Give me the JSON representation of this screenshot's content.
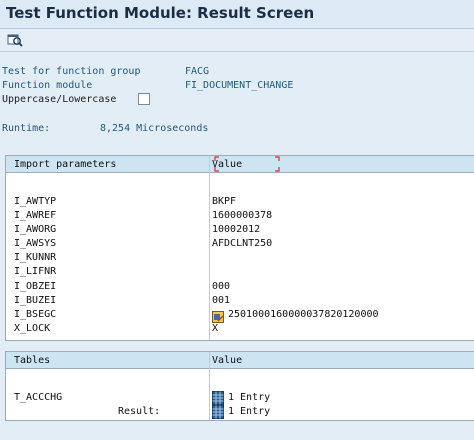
{
  "window": {
    "title": "Test Function Module: Result Screen"
  },
  "toolbar": {
    "icon": "display-magnifier-icon"
  },
  "header": {
    "group_label": "Test for function group",
    "group_value": "FACG",
    "module_label": "Function module",
    "module_value": "FI_DOCUMENT_CHANGE",
    "case_label": "Uppercase/Lowercase",
    "case_checked": false,
    "runtime_label": "Runtime:",
    "runtime_value": "8,254 Microseconds"
  },
  "import_table": {
    "col1": "Import parameters",
    "col2": "Value",
    "rows": [
      {
        "name": "I_AWTYP",
        "value": "BKPF"
      },
      {
        "name": "I_AWREF",
        "value": "1600000378"
      },
      {
        "name": "I_AWORG",
        "value": "10002012"
      },
      {
        "name": "I_AWSYS",
        "value": "AFDCLNT250"
      },
      {
        "name": "I_KUNNR",
        "value": ""
      },
      {
        "name": "I_LIFNR",
        "value": ""
      },
      {
        "name": "I_OBZEI",
        "value": "000"
      },
      {
        "name": "I_BUZEI",
        "value": "001"
      },
      {
        "name": "I_BSEGC",
        "value": "2501000160000037820120000",
        "icon": "structure-edit-icon"
      },
      {
        "name": "X_LOCK",
        "value": "X"
      }
    ]
  },
  "tables_table": {
    "col1": "Tables",
    "col2": "Value",
    "rows": [
      {
        "name": "T_ACCCHG",
        "value": "1 Entry",
        "icon": "table-grid-icon"
      },
      {
        "name": "Result:",
        "value": "1 Entry",
        "icon": "table-grid-icon"
      }
    ]
  },
  "colors": {
    "label_teal": "#1e5a7a",
    "header_blue": "#cde4f3",
    "focus_red": "#d0302a"
  }
}
